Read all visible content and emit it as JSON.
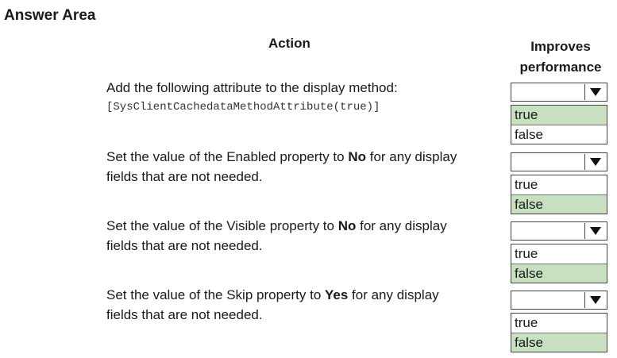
{
  "title": "Answer Area",
  "headers": {
    "action": "Action",
    "improves_line1": "Improves",
    "improves_line2": "performance"
  },
  "rows": [
    {
      "text_line1": "Add the following attribute to the display method:",
      "code": "[SysClientCachedataMethodAttribute(true)]",
      "options": [
        "true",
        "false"
      ],
      "selected": "true"
    },
    {
      "pre": "Set the value of the Enabled property to ",
      "bold": "No",
      "post": " for any display",
      "line2": "fields that are not needed.",
      "options": [
        "true",
        "false"
      ],
      "selected": "false"
    },
    {
      "pre": "Set the value of the Visible property to ",
      "bold": "No",
      "post": " for any display",
      "line2": "fields that are not needed.",
      "options": [
        "true",
        "false"
      ],
      "selected": "false"
    },
    {
      "pre": "Set the value of the Skip property to ",
      "bold": "Yes",
      "post": " for any display",
      "line2": "fields that are not needed.",
      "options": [
        "true",
        "false"
      ],
      "selected": "false"
    }
  ],
  "colors": {
    "selected_bg": "#c6e0c0"
  }
}
